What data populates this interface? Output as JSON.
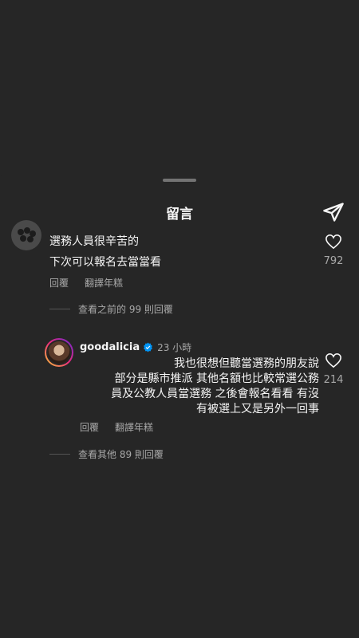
{
  "sheet": {
    "title": "留言"
  },
  "comment1": {
    "lines": [
      "選務人員很辛苦的",
      "下次可以報名去當當看"
    ],
    "like_count": "792",
    "reply_label": "回覆",
    "translate_label": "翻譯年糕",
    "view_replies": "查看之前的 99 則回覆"
  },
  "comment2": {
    "username": "goodalicia",
    "time": "23 小時",
    "lines": [
      "我也很想但聽當選務的朋友說",
      "部分是縣市推派 其他名額也比較常選公務",
      "員及公教人員當選務 之後會報名看看 有沒",
      "有被選上又是另外一回事"
    ],
    "like_count": "214",
    "reply_label": "回覆",
    "translate_label": "翻譯年糕",
    "view_replies": "查看其他 89 則回覆"
  },
  "icons": {
    "send": "send-icon",
    "like": "heart-outline-icon",
    "verified": "verified-badge-icon"
  },
  "colors": {
    "background": "#262626",
    "text": "#f5f5f5",
    "muted": "#a8a8a8",
    "verified": "#0095f6"
  }
}
